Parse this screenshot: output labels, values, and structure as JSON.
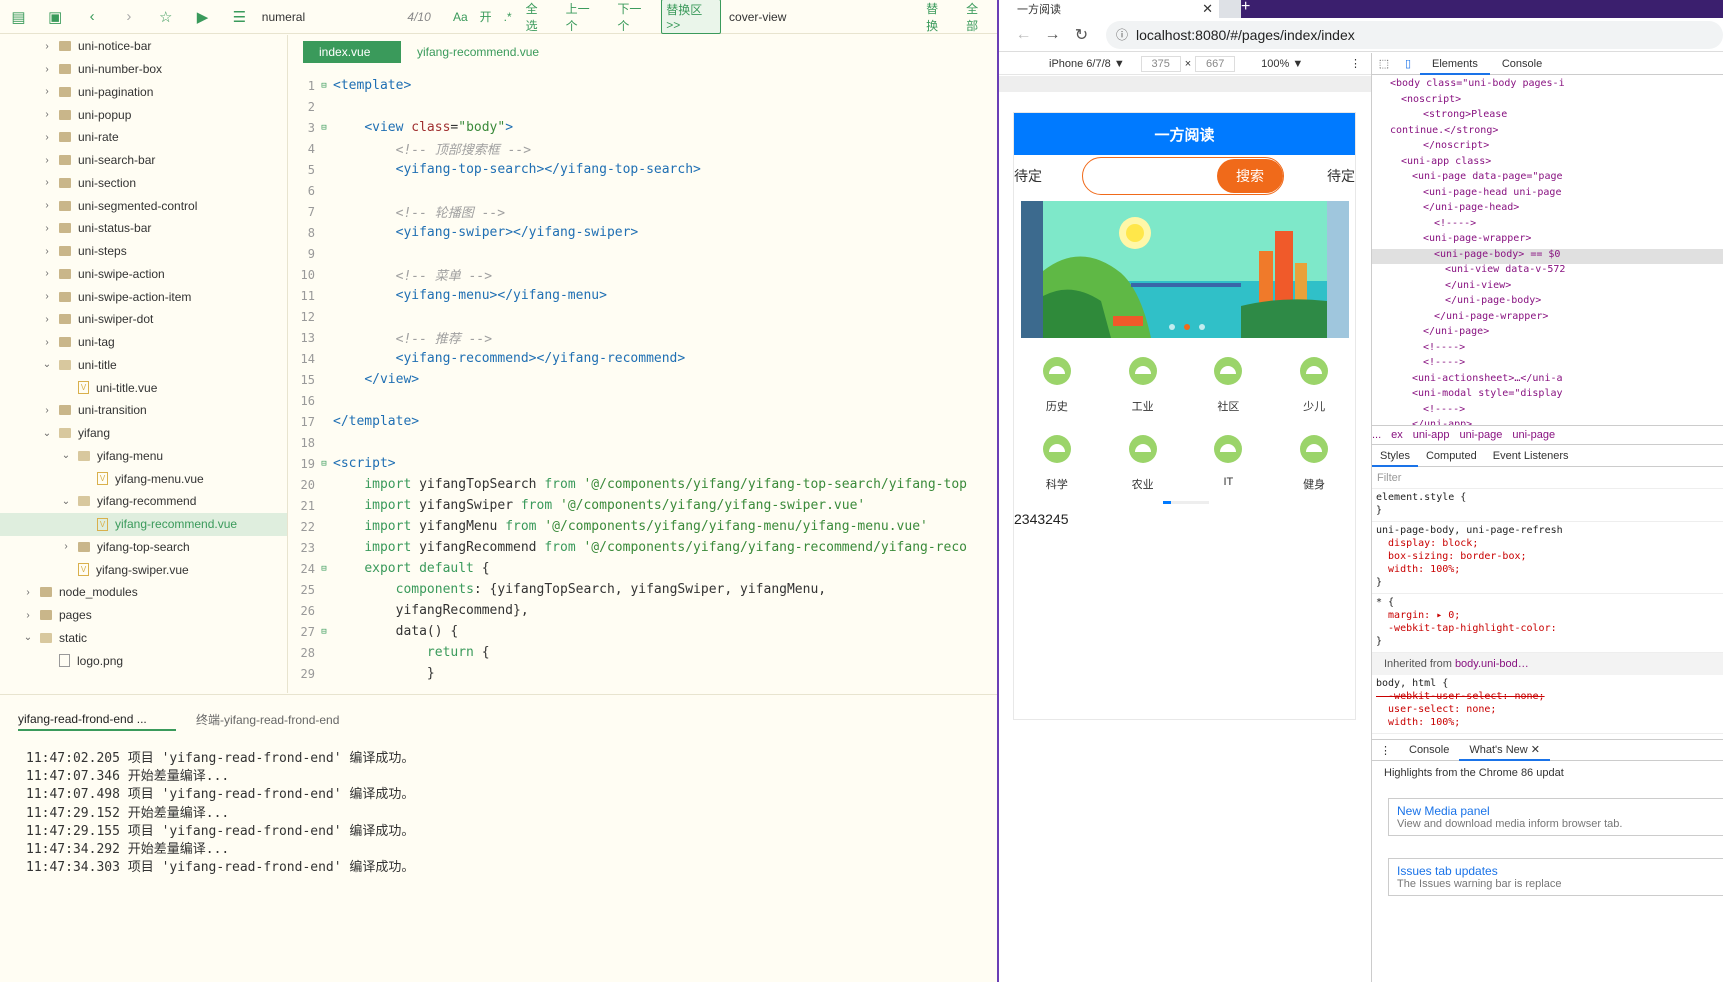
{
  "toolbar": {
    "search_value": "numeral",
    "match_count": "4/10",
    "opt_case": "Aa",
    "opt_word": "开",
    "opt_regex": ".*",
    "select_all": "全选",
    "prev": "上一个",
    "next": "下一个",
    "replace_area": "替换区>>",
    "replace_value": "cover-view",
    "replace": "替换",
    "replace_all": "全部"
  },
  "tree": [
    {
      "label": "uni-notice-bar",
      "type": "folder",
      "depth": 2,
      "open": false
    },
    {
      "label": "uni-number-box",
      "type": "folder",
      "depth": 2,
      "open": false
    },
    {
      "label": "uni-pagination",
      "type": "folder",
      "depth": 2,
      "open": false
    },
    {
      "label": "uni-popup",
      "type": "folder",
      "depth": 2,
      "open": false
    },
    {
      "label": "uni-rate",
      "type": "folder",
      "depth": 2,
      "open": false
    },
    {
      "label": "uni-search-bar",
      "type": "folder",
      "depth": 2,
      "open": false
    },
    {
      "label": "uni-section",
      "type": "folder",
      "depth": 2,
      "open": false
    },
    {
      "label": "uni-segmented-control",
      "type": "folder",
      "depth": 2,
      "open": false
    },
    {
      "label": "uni-status-bar",
      "type": "folder",
      "depth": 2,
      "open": false
    },
    {
      "label": "uni-steps",
      "type": "folder",
      "depth": 2,
      "open": false
    },
    {
      "label": "uni-swipe-action",
      "type": "folder",
      "depth": 2,
      "open": false
    },
    {
      "label": "uni-swipe-action-item",
      "type": "folder",
      "depth": 2,
      "open": false
    },
    {
      "label": "uni-swiper-dot",
      "type": "folder",
      "depth": 2,
      "open": false
    },
    {
      "label": "uni-tag",
      "type": "folder",
      "depth": 2,
      "open": false
    },
    {
      "label": "uni-title",
      "type": "folder",
      "depth": 2,
      "open": true
    },
    {
      "label": "uni-title.vue",
      "type": "vue",
      "depth": 3
    },
    {
      "label": "uni-transition",
      "type": "folder",
      "depth": 2,
      "open": false
    },
    {
      "label": "yifang",
      "type": "folder",
      "depth": 2,
      "open": true
    },
    {
      "label": "yifang-menu",
      "type": "folder",
      "depth": 3,
      "open": true
    },
    {
      "label": "yifang-menu.vue",
      "type": "vue",
      "depth": 4
    },
    {
      "label": "yifang-recommend",
      "type": "folder",
      "depth": 3,
      "open": true
    },
    {
      "label": "yifang-recommend.vue",
      "type": "vue",
      "depth": 4,
      "selected": true
    },
    {
      "label": "yifang-top-search",
      "type": "folder",
      "depth": 3,
      "open": false
    },
    {
      "label": "yifang-swiper.vue",
      "type": "vue",
      "depth": 3
    },
    {
      "label": "node_modules",
      "type": "folder",
      "depth": 1,
      "open": false
    },
    {
      "label": "pages",
      "type": "folder",
      "depth": 1,
      "open": false
    },
    {
      "label": "static",
      "type": "folder",
      "depth": 1,
      "open": true
    },
    {
      "label": "logo.png",
      "type": "img",
      "depth": 2
    }
  ],
  "editor_tabs": [
    "index.vue",
    "yifang-recommend.vue"
  ],
  "code": [
    {
      "n": "1",
      "fold": "⊟",
      "segs": [
        [
          "tag",
          "<template>"
        ]
      ]
    },
    {
      "n": "2",
      "fold": "",
      "segs": []
    },
    {
      "n": "3",
      "fold": "⊟",
      "segs": [
        [
          "tx",
          "    "
        ],
        [
          "tag",
          "<view "
        ],
        [
          "attr",
          "class"
        ],
        [
          "tx",
          "="
        ],
        [
          "str",
          "\"body\""
        ],
        [
          "tag",
          ">"
        ]
      ]
    },
    {
      "n": "4",
      "fold": "",
      "segs": [
        [
          "tx",
          "        "
        ],
        [
          "cmt",
          "<!-- 顶部搜索框 -->"
        ]
      ]
    },
    {
      "n": "5",
      "fold": "",
      "segs": [
        [
          "tx",
          "        "
        ],
        [
          "tag",
          "<yifang-top-search></yifang-top-search>"
        ]
      ]
    },
    {
      "n": "6",
      "fold": "",
      "segs": []
    },
    {
      "n": "7",
      "fold": "",
      "segs": [
        [
          "tx",
          "        "
        ],
        [
          "cmt",
          "<!-- 轮播图 -->"
        ]
      ]
    },
    {
      "n": "8",
      "fold": "",
      "segs": [
        [
          "tx",
          "        "
        ],
        [
          "tag",
          "<yifang-swiper></yifang-swiper>"
        ]
      ]
    },
    {
      "n": "9",
      "fold": "",
      "segs": []
    },
    {
      "n": "10",
      "fold": "",
      "segs": [
        [
          "tx",
          "        "
        ],
        [
          "cmt",
          "<!-- 菜单 -->"
        ]
      ]
    },
    {
      "n": "11",
      "fold": "",
      "segs": [
        [
          "tx",
          "        "
        ],
        [
          "tag",
          "<yifang-menu></yifang-menu>"
        ]
      ]
    },
    {
      "n": "12",
      "fold": "",
      "segs": []
    },
    {
      "n": "13",
      "fold": "",
      "segs": [
        [
          "tx",
          "        "
        ],
        [
          "cmt",
          "<!-- 推荐 -->"
        ]
      ]
    },
    {
      "n": "14",
      "fold": "",
      "segs": [
        [
          "tx",
          "        "
        ],
        [
          "tag",
          "<yifang-recommend></yifang-recommend>"
        ]
      ]
    },
    {
      "n": "15",
      "fold": "",
      "segs": [
        [
          "tx",
          "    "
        ],
        [
          "tag",
          "</view>"
        ]
      ]
    },
    {
      "n": "16",
      "fold": "",
      "segs": []
    },
    {
      "n": "17",
      "fold": "",
      "segs": [
        [
          "tag",
          "</template>"
        ]
      ]
    },
    {
      "n": "18",
      "fold": "",
      "segs": []
    },
    {
      "n": "19",
      "fold": "⊟",
      "segs": [
        [
          "tag",
          "<script>"
        ]
      ]
    },
    {
      "n": "20",
      "fold": "",
      "segs": [
        [
          "tx",
          "    "
        ],
        [
          "kw",
          "import"
        ],
        [
          "tx",
          " yifangTopSearch "
        ],
        [
          "kw",
          "from"
        ],
        [
          "tx",
          " "
        ],
        [
          "str",
          "'@/components/yifang/yifang-top-search/yifang-top"
        ]
      ]
    },
    {
      "n": "21",
      "fold": "",
      "segs": [
        [
          "tx",
          "    "
        ],
        [
          "kw",
          "import"
        ],
        [
          "tx",
          " yifangSwiper "
        ],
        [
          "kw",
          "from"
        ],
        [
          "tx",
          " "
        ],
        [
          "str",
          "'@/components/yifang/yifang-swiper.vue'"
        ]
      ]
    },
    {
      "n": "22",
      "fold": "",
      "segs": [
        [
          "tx",
          "    "
        ],
        [
          "kw",
          "import"
        ],
        [
          "tx",
          " yifangMenu "
        ],
        [
          "kw",
          "from"
        ],
        [
          "tx",
          " "
        ],
        [
          "str",
          "'@/components/yifang/yifang-menu/yifang-menu.vue'"
        ]
      ]
    },
    {
      "n": "23",
      "fold": "",
      "segs": [
        [
          "tx",
          "    "
        ],
        [
          "kw",
          "import"
        ],
        [
          "tx",
          " yifangRecommend "
        ],
        [
          "kw",
          "from"
        ],
        [
          "tx",
          " "
        ],
        [
          "str",
          "'@/components/yifang/yifang-recommend/yifang-reco"
        ]
      ]
    },
    {
      "n": "24",
      "fold": "⊟",
      "segs": [
        [
          "tx",
          "    "
        ],
        [
          "kw",
          "export default"
        ],
        [
          "tx",
          " {"
        ]
      ]
    },
    {
      "n": "25",
      "fold": "",
      "segs": [
        [
          "tx",
          "        "
        ],
        [
          "kw",
          "components"
        ],
        [
          "tx",
          ": {yifangTopSearch, yifangSwiper, yifangMenu,"
        ]
      ]
    },
    {
      "n": "26",
      "fold": "",
      "segs": [
        [
          "tx",
          "        yifangRecommend},"
        ]
      ]
    },
    {
      "n": "27",
      "fold": "⊟",
      "segs": [
        [
          "tx",
          "        data() {"
        ]
      ]
    },
    {
      "n": "28",
      "fold": "",
      "segs": [
        [
          "tx",
          "            "
        ],
        [
          "kw",
          "return"
        ],
        [
          "tx",
          " {"
        ]
      ]
    },
    {
      "n": "29",
      "fold": "",
      "segs": [
        [
          "tx",
          "            }"
        ]
      ]
    }
  ],
  "console": {
    "tabs": [
      "yifang-read-frond-end ...",
      "终端-yifang-read-frond-end"
    ],
    "lines": [
      "11:47:02.205 项目 'yifang-read-frond-end' 编译成功。",
      "11:47:07.346 开始差量编译...",
      "11:47:07.498 项目 'yifang-read-frond-end' 编译成功。",
      "11:47:29.152 开始差量编译...",
      "11:47:29.155 项目 'yifang-read-frond-end' 编译成功。",
      "11:47:34.292 开始差量编译...",
      "11:47:34.303 项目 'yifang-read-frond-end' 编译成功。"
    ]
  },
  "browser": {
    "tab_title": "一方阅读",
    "url": "localhost:8080/#/pages/index/index",
    "device": "iPhone 6/7/8 ▼",
    "width": "375",
    "height": "667",
    "zoom": "100% ▼"
  },
  "phone": {
    "title": "一方阅读",
    "left_label": "待定",
    "right_label": "待定",
    "search_button": "搜索",
    "menu": [
      "历史",
      "工业",
      "社区",
      "少儿",
      "科学",
      "农业",
      "IT",
      "健身"
    ],
    "recommend_text": "2343245"
  },
  "devtools": {
    "tabs": [
      "Elements",
      "Console"
    ],
    "dom": [
      {
        "i": 0,
        "html": "<body class=\"uni-body pages-i"
      },
      {
        "i": 1,
        "html": "<noscript>"
      },
      {
        "i": 3,
        "html": "<strong>Please"
      },
      {
        "i": 0,
        "html": "continue.</strong>"
      },
      {
        "i": 3,
        "html": "</noscript>"
      },
      {
        "i": 1,
        "html": "<uni-app class>"
      },
      {
        "i": 2,
        "html": "<uni-page data-page=\"page"
      },
      {
        "i": 3,
        "html": "<uni-page-head uni-page"
      },
      {
        "i": 3,
        "html": "</uni-page-head>"
      },
      {
        "i": 4,
        "html": "<!---->"
      },
      {
        "i": 3,
        "html": "<uni-page-wrapper>"
      },
      {
        "i": 4,
        "html": "<uni-page-body> == $0",
        "sel": true
      },
      {
        "i": 5,
        "html": "<uni-view data-v-572"
      },
      {
        "i": 5,
        "html": "</uni-view>"
      },
      {
        "i": 5,
        "html": "</uni-page-body>"
      },
      {
        "i": 4,
        "html": "</uni-page-wrapper>"
      },
      {
        "i": 3,
        "html": "</uni-page>"
      },
      {
        "i": 3,
        "html": "<!---->"
      },
      {
        "i": 3,
        "html": "<!---->"
      },
      {
        "i": 2,
        "html": "<uni-actionsheet>…</uni-a"
      },
      {
        "i": 2,
        "html": "<uni-modal style=\"display"
      },
      {
        "i": 3,
        "html": "<!---->"
      },
      {
        "i": 2,
        "html": "</uni-app>"
      }
    ],
    "crumbs": [
      "...",
      "ex",
      "uni-app",
      "uni-page",
      "uni-page"
    ],
    "style_tabs": [
      "Styles",
      "Computed",
      "Event Listeners"
    ],
    "filter": "Filter",
    "rules": [
      [
        "element.style {",
        "}"
      ],
      [
        "uni-page-body, uni-page-refresh",
        "  display: block;",
        "  box-sizing: border-box;",
        "  width: 100%;",
        "}"
      ],
      [
        "* {",
        "  margin: ▸ 0;",
        "  -webkit-tap-highlight-color:",
        "}"
      ]
    ],
    "inherited": "Inherited from",
    "inherited_el": "body.uni-bod…",
    "body_rule": [
      "body, html {",
      "  -webkit-user-select: none;",
      "  user-select: none;",
      "  width: 100%;"
    ],
    "drawer_tabs": [
      "Console",
      "What's New ✕"
    ],
    "highlights": "Highlights from the Chrome 86 updat",
    "cards": [
      {
        "title": "New Media panel",
        "desc": "View and download media inform browser tab."
      },
      {
        "title": "Issues tab updates",
        "desc": "The Issues warning bar is replace"
      }
    ]
  }
}
